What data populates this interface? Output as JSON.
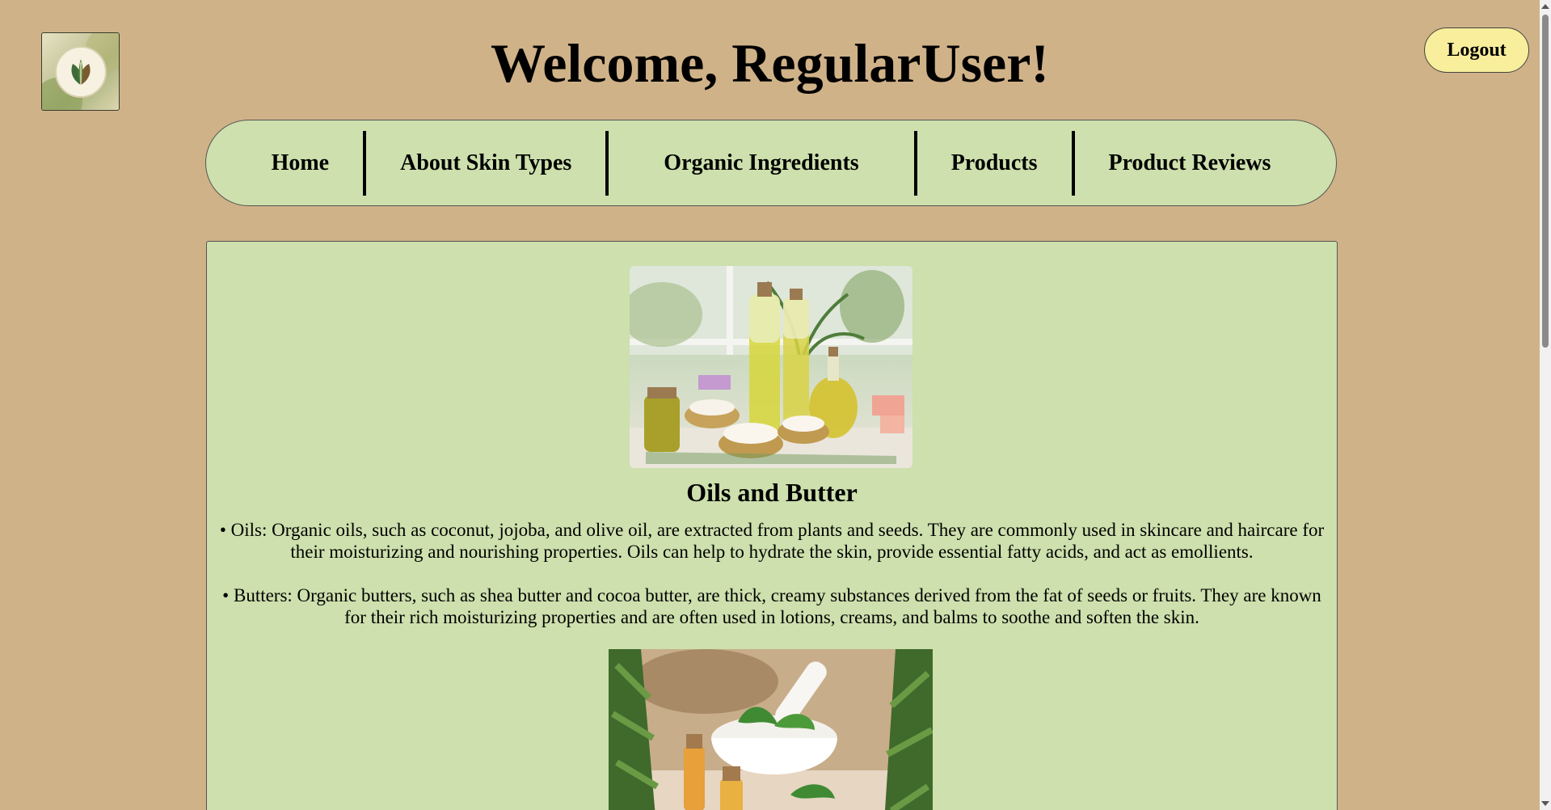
{
  "header": {
    "title": "Welcome, RegularUser!",
    "logo_icon": "leaf-logo-icon",
    "logout_label": "Logout"
  },
  "nav": {
    "items": [
      {
        "label": "Home"
      },
      {
        "label": "About Skin Types"
      },
      {
        "label": "Organic Ingredients"
      },
      {
        "label": "Products"
      },
      {
        "label": "Product Reviews"
      }
    ]
  },
  "content": {
    "image1_subject": "oils-and-butter-photo",
    "section_title": "Oils and Butter",
    "paragraph_oils": "• Oils: Organic oils, such as coconut, jojoba, and olive oil, are extracted from plants and seeds. They are commonly used in skincare and haircare for their moisturizing and nourishing properties. Oils can help to hydrate the skin, provide essential fatty acids, and act as emollients.",
    "paragraph_butters": "• Butters: Organic butters, such as shea butter and cocoa butter, are thick, creamy substances derived from the fat of seeds or fruits. They are known for their rich moisturizing properties and are often used in lotions, creams, and balms to soothe and soften the skin.",
    "image2_subject": "mortar-herbs-photo"
  },
  "colors": {
    "background": "#d0b288",
    "panel": "#cde0ad",
    "logout_button": "#f8ee9b"
  }
}
